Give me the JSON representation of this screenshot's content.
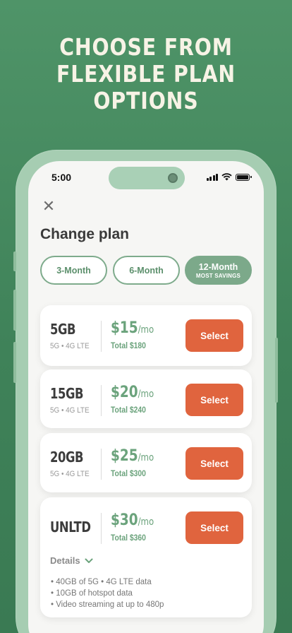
{
  "headline": [
    "CHOOSE FROM",
    "FLEXIBLE PLAN",
    "OPTIONS"
  ],
  "status": {
    "time": "5:00"
  },
  "header": {
    "close_icon": "close-icon",
    "title": "Change plan"
  },
  "tabs": [
    {
      "label": "3-Month",
      "sub": "",
      "active": false
    },
    {
      "label": "6-Month",
      "sub": "",
      "active": false
    },
    {
      "label": "12-Month",
      "sub": "MOST SAVINGS",
      "active": true
    }
  ],
  "plans": [
    {
      "name": "5GB",
      "network": "5G • 4G LTE",
      "price": "$15",
      "unit": "/mo",
      "total": "Total $180",
      "select": "Select"
    },
    {
      "name": "15GB",
      "network": "5G • 4G LTE",
      "price": "$20",
      "unit": "/mo",
      "total": "Total $240",
      "select": "Select"
    },
    {
      "name": "20GB",
      "network": "5G • 4G LTE",
      "price": "$25",
      "unit": "/mo",
      "total": "Total $300",
      "select": "Select"
    },
    {
      "name": "UNLTD",
      "network": "",
      "price": "$30",
      "unit": "/mo",
      "total": "Total $360",
      "select": "Select",
      "details_label": "Details",
      "features": [
        "• 40GB of 5G • 4G LTE data",
        "• 10GB of hotspot data",
        "• Video streaming at up to 480p"
      ]
    }
  ],
  "colors": {
    "background": "#4a8c61",
    "accent": "#e0643e",
    "primary_green": "#6ba37c",
    "headline": "#f7f3e6"
  }
}
